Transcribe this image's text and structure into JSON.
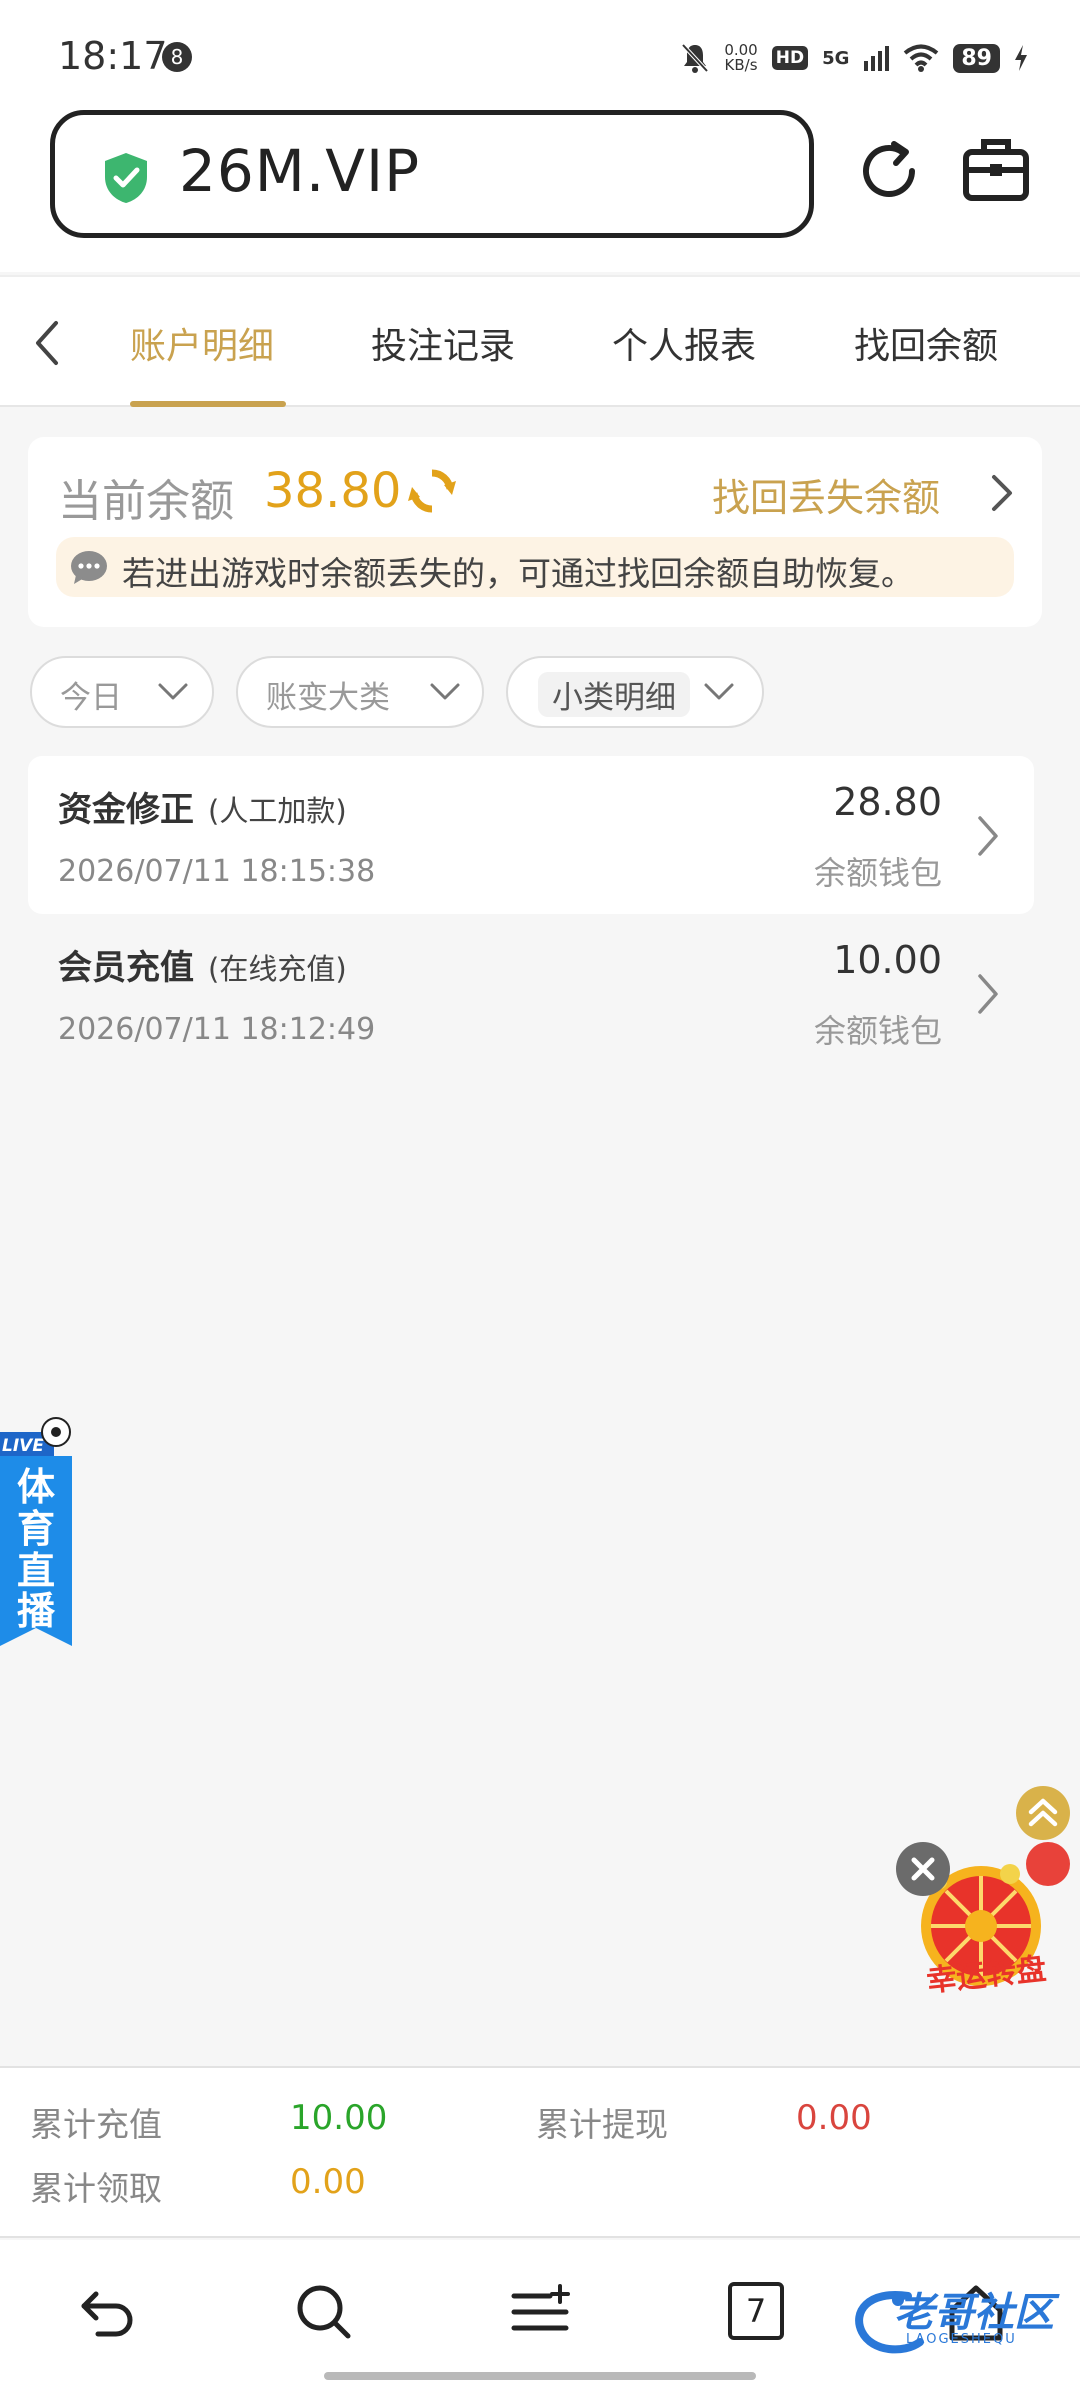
{
  "status_bar": {
    "time": "18:17",
    "notification_count": "8",
    "speed_value": "0.00",
    "speed_unit": "KB/s",
    "hd": "HD",
    "network": "5G",
    "battery": "89"
  },
  "browser": {
    "url": "26M.VIP"
  },
  "tabs": [
    {
      "label": "账户明细",
      "active": true
    },
    {
      "label": "投注记录"
    },
    {
      "label": "个人报表"
    },
    {
      "label": "找回余额"
    }
  ],
  "balance": {
    "label": "当前余额",
    "value": "38.80",
    "recover_link": "找回丢失余额",
    "notice": "若进出游戏时余额丢失的，可通过找回余额自助恢复。"
  },
  "filters": [
    {
      "label": "今日"
    },
    {
      "label": "账变大类"
    },
    {
      "label": "小类明细"
    }
  ],
  "records": [
    {
      "title": "资金修正",
      "subtitle": "(人工加款)",
      "time": "2026/07/11 18:15:38",
      "amount": "28.80",
      "wallet": "余额钱包"
    },
    {
      "title": "会员充值",
      "subtitle": "(在线充值)",
      "time": "2026/07/11 18:12:49",
      "amount": "10.00",
      "wallet": "余额钱包"
    }
  ],
  "live_banner": {
    "badge": "LIVE",
    "chars": [
      "体",
      "育",
      "直",
      "播"
    ]
  },
  "lucky_wheel": {
    "label": "幸运转盘"
  },
  "summary": {
    "recharge_label": "累计充值",
    "recharge_value": "10.00",
    "withdraw_label": "累计提现",
    "withdraw_value": "0.00",
    "claim_label": "累计领取",
    "claim_value": "0.00"
  },
  "bottom_nav": {
    "tab_count": "7",
    "watermark": "老哥社区",
    "watermark_sub": "LAOGESHEQU"
  },
  "colors": {
    "accent_gold": "#c9a24f",
    "balance_orange": "#e2a21a",
    "green": "#2aa52a",
    "red": "#d9453e"
  }
}
